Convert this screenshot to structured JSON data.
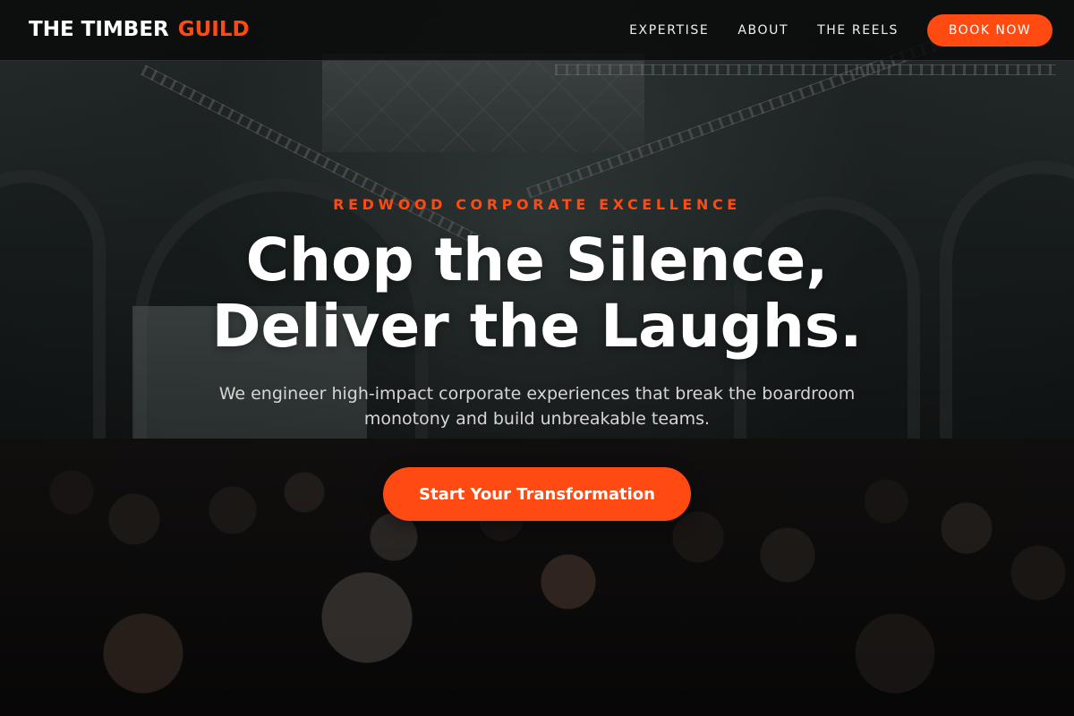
{
  "colors": {
    "accent": "#ff4a12",
    "nav_background": "#080808",
    "text_primary": "#ffffff",
    "text_secondary": "#d6d6d6"
  },
  "header": {
    "logo": {
      "primary": "THE TIMBER",
      "accent": "GUILD"
    },
    "nav_links": [
      "EXPERTISE",
      "ABOUT",
      "THE REELS"
    ],
    "book_button": "BOOK NOW"
  },
  "hero": {
    "background_image": "conference-hall-crowd-photo",
    "eyebrow": "REDWOOD CORPORATE EXCELLENCE",
    "headline_lines": [
      "Chop the Silence,",
      "Deliver the Laughs."
    ],
    "subtext": "We engineer high-impact corporate experiences that break the boardroom monotony and build unbreakable teams.",
    "cta": "Start Your Transformation"
  }
}
